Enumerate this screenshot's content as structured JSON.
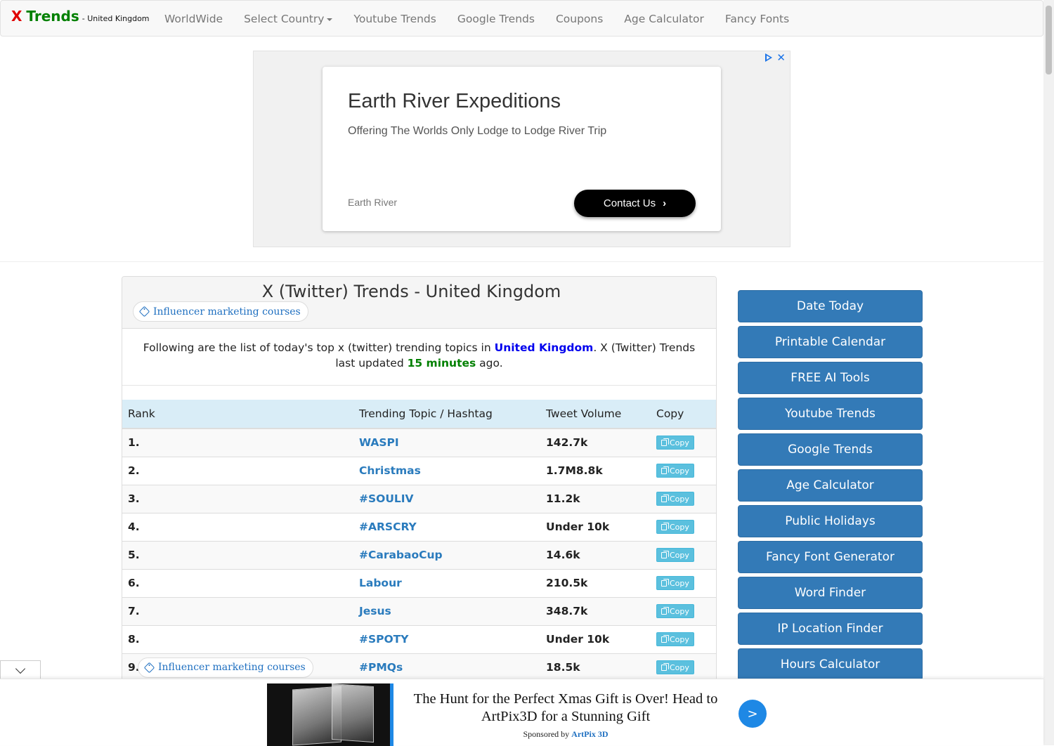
{
  "navbar": {
    "brand_x": "X",
    "brand_trends": "Trends",
    "brand_country": "- United Kingdom",
    "links": [
      "WorldWide",
      "Select Country",
      "Youtube Trends",
      "Google Trends",
      "Coupons",
      "Age Calculator",
      "Fancy Fonts"
    ]
  },
  "top_ad": {
    "title": "Earth River Expeditions",
    "subtitle": "Offering The Worlds Only Lodge to Lodge River Trip",
    "advertiser": "Earth River",
    "cta": "Contact Us",
    "icons": [
      "adchoices-icon",
      "close-icon"
    ]
  },
  "main": {
    "title": "X (Twitter) Trends - United Kingdom",
    "tag_link": "Influencer marketing courses",
    "desc_prefix": "Following are the list of today's top x (twitter) trending topics in ",
    "desc_country": "United Kingdom",
    "desc_middle": ". X (Twitter) Trends last updated ",
    "desc_time": "15 minutes",
    "desc_suffix": " ago."
  },
  "table": {
    "headers": [
      "Rank",
      "Trending Topic / Hashtag",
      "Tweet Volume",
      "Copy"
    ],
    "copy_label": "Copy",
    "rows": [
      {
        "rank": "1.",
        "topic": "WASPI",
        "volume": "142.7k"
      },
      {
        "rank": "2.",
        "topic": "Christmas",
        "volume": "1.7M8.8k"
      },
      {
        "rank": "3.",
        "topic": "#SOULIV",
        "volume": "11.2k"
      },
      {
        "rank": "4.",
        "topic": "#ARSCRY",
        "volume": "Under 10k"
      },
      {
        "rank": "5.",
        "topic": "#CarabaoCup",
        "volume": "14.6k"
      },
      {
        "rank": "6.",
        "topic": "Labour",
        "volume": "210.5k"
      },
      {
        "rank": "7.",
        "topic": "Jesus",
        "volume": "348.7k"
      },
      {
        "rank": "8.",
        "topic": "#SPOTY",
        "volume": "Under 10k"
      },
      {
        "rank": "9.",
        "topic": "#PMQs",
        "volume": "18.5k"
      }
    ],
    "row9_tag": "Influencer marketing courses"
  },
  "sidebar": {
    "buttons": [
      "Date Today",
      "Printable Calendar",
      "FREE AI Tools",
      "Youtube Trends",
      "Google Trends",
      "Age Calculator",
      "Public Holidays",
      "Fancy Font Generator",
      "Word Finder",
      "IP Location Finder",
      "Hours Calculator"
    ]
  },
  "bottom_ad": {
    "headline": "The Hunt for the Perfect Xmas Gift is Over! Head to ArtPix3D for a Stunning Gift",
    "sponsored_by": "Sponsored by ",
    "sponsor": "ArtPix 3D",
    "go": ">"
  },
  "colors": {
    "brand_red": "#e00000",
    "brand_green": "#008000",
    "primary_button": "#337ab7",
    "copy_button": "#5bc0de",
    "table_header": "#d9edf7",
    "topic_link": "#2a7bbd"
  }
}
